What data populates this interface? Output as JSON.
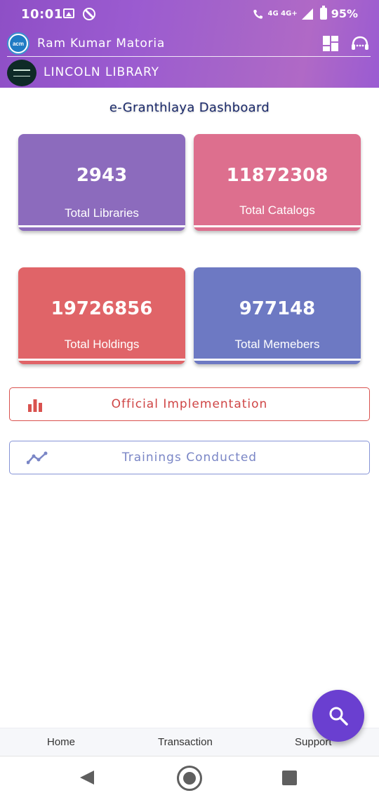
{
  "status_bar": {
    "time": "10:01",
    "network": "4G 4G+",
    "battery": "95%"
  },
  "header": {
    "user_name": "Ram Kumar Matoria",
    "library_name": "LINCOLN LIBRARY",
    "app_logo_text": "acm",
    "icons": [
      "dashboard-grid-icon",
      "support-headset-icon"
    ]
  },
  "dashboard": {
    "title": "e-Granthlaya Dashboard",
    "cards": [
      {
        "value": "2943",
        "label": "Total Libraries",
        "color": "#8c6bbd"
      },
      {
        "value": "11872308",
        "label": "Total Catalogs",
        "color": "#dd6f8e"
      },
      {
        "value": "19726856",
        "label": "Total Holdings",
        "color": "#e06468"
      },
      {
        "value": "977148",
        "label": "Total Memebers",
        "color": "#6d79c3"
      }
    ],
    "actions": [
      {
        "label": "Official Implementation",
        "icon": "bar-chart-icon",
        "color": "#cf4545"
      },
      {
        "label": "Trainings Conducted",
        "icon": "line-chart-icon",
        "color": "#7a86c6"
      }
    ]
  },
  "bottom_nav": {
    "items": [
      "Home",
      "Transaction",
      "Support"
    ]
  },
  "fab": {
    "icon": "search-icon",
    "color": "#6a3fd0"
  },
  "system_nav": {
    "icons": [
      "back-icon",
      "home-icon",
      "recents-icon"
    ]
  }
}
